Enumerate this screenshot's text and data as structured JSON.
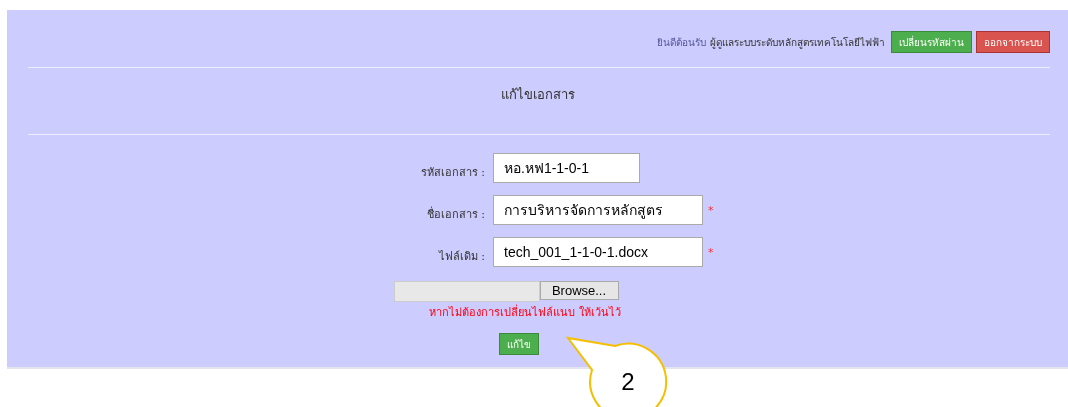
{
  "header": {
    "welcome": "ยินดีต้อนรับ",
    "user": "ผู้ดูแลระบบระดับหลักสูตรเทคโนโลยีไฟฟ้า",
    "buttons": [
      {
        "label": "เปลี่ยนรหัสผ่าน",
        "kind": "success"
      },
      {
        "label": "ออกจากระบบ",
        "kind": "danger"
      }
    ]
  },
  "title": "แก้ไขเอกสาร",
  "fields": [
    {
      "label": "รหัสเอกสาร :",
      "value": "หอ.หฟ1-1-0-1"
    },
    {
      "label": "ชื่อเอกสาร :",
      "value": "การบริหารจัดการหลักสูตร",
      "required_mark": "*"
    },
    {
      "label": "ไฟล์เดิม :",
      "value": "tech_001_1-1-0-1.docx",
      "required_mark": "*"
    }
  ],
  "file_input": {
    "button": "Browse..."
  },
  "hint": "หากไม่ต้องการเปลี่ยนไฟล์แนบ ให้เว้นไว้",
  "submit": "แก้ไข",
  "callout": "2"
}
